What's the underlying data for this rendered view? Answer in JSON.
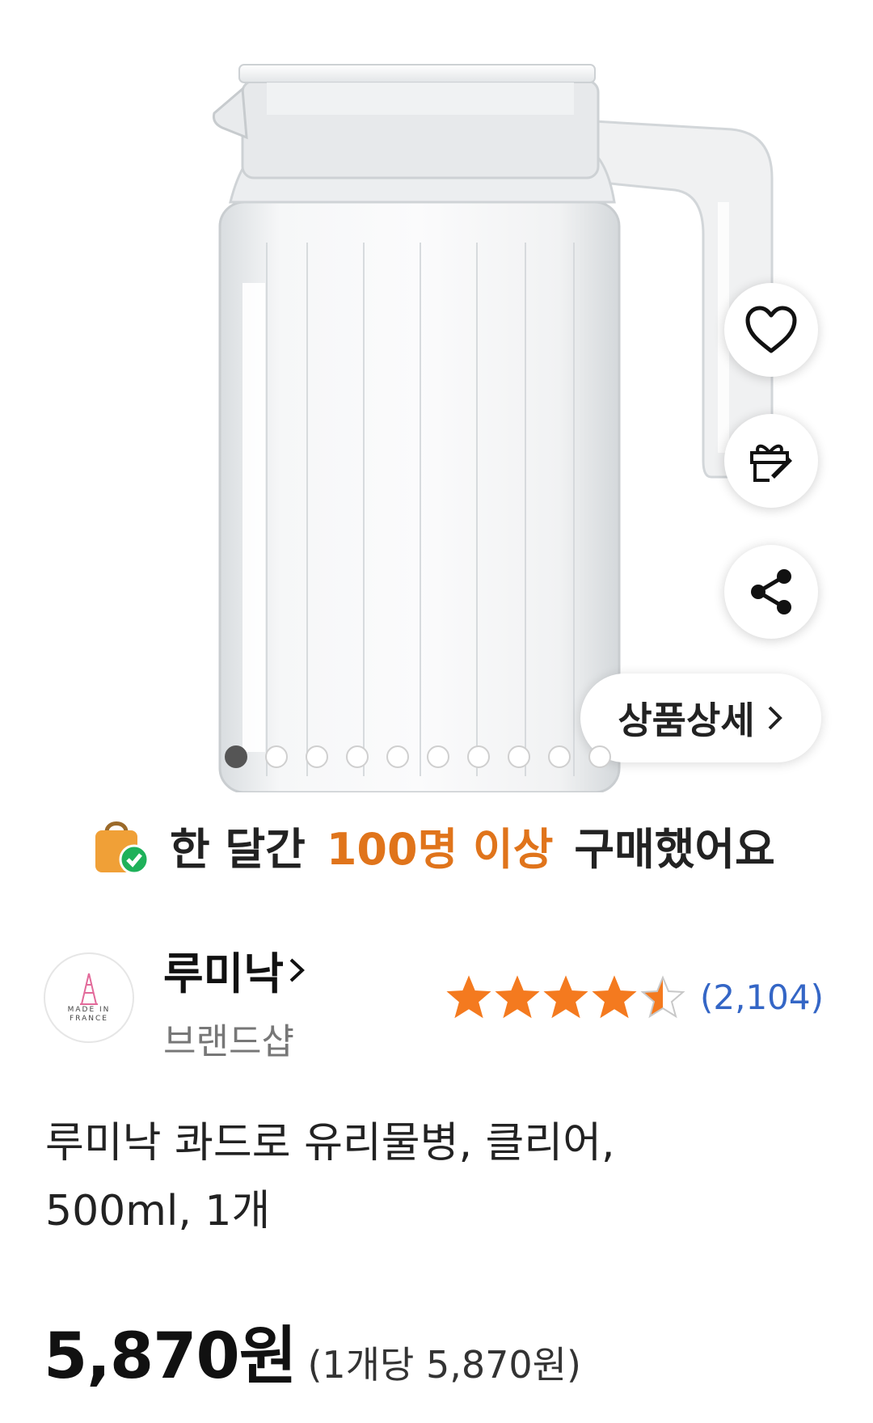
{
  "actions": {
    "wishlist_icon": "heart-icon",
    "gift_icon": "gift-icon",
    "share_icon": "share-icon",
    "detail_label": "상품상세"
  },
  "gallery": {
    "total_images": 10,
    "active_index": 1
  },
  "promo": {
    "prefix": "한 달간",
    "highlight": "100명 이상",
    "suffix": "구매했어요",
    "highlight_color": "#e0741b"
  },
  "brand": {
    "name": "루미낙",
    "type": "브랜드샵",
    "logo_text_line1": "MADE IN",
    "logo_text_line2": "FRANCE"
  },
  "rating": {
    "stars": 4.5,
    "count": "(2,104)",
    "star_color": "#f47a1f",
    "count_color": "#3466c6"
  },
  "product": {
    "title_line1": "루미낙 콰드로 유리물병, 클리어,",
    "title_line2": "500ml, 1개"
  },
  "price": {
    "main": "5,870원",
    "unit_price": "(1개당 5,870원)"
  }
}
